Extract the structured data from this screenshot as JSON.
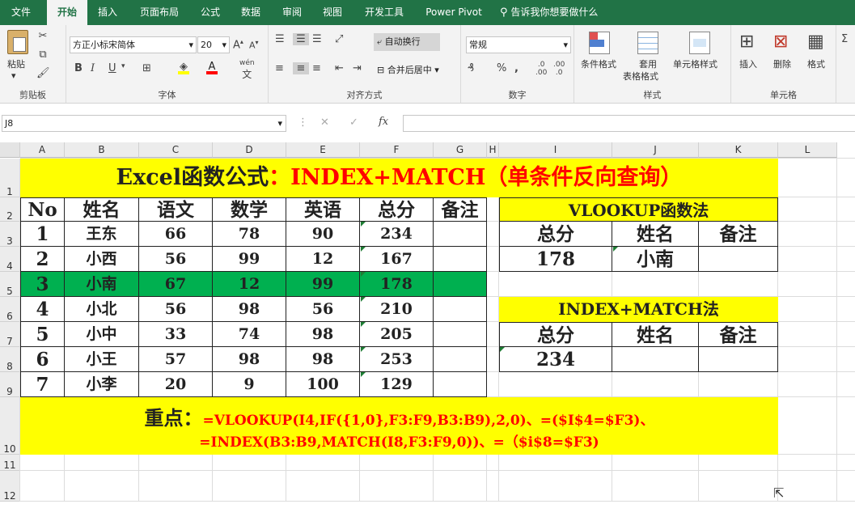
{
  "tabs": [
    "文件",
    "开始",
    "插入",
    "页面布局",
    "公式",
    "数据",
    "审阅",
    "视图",
    "开发工具",
    "Power Pivot"
  ],
  "tell_me": "告诉我你想要做什么",
  "ribbon": {
    "clipboard": {
      "paste": "粘贴",
      "label": "剪贴板"
    },
    "font": {
      "name": "方正小标宋简体",
      "size": "20",
      "label": "字体",
      "wen": "wén"
    },
    "align": {
      "wrap": "自动换行",
      "merge": "合并后居中",
      "label": "对齐方式"
    },
    "number": {
      "format": "常规",
      "label": "数字"
    },
    "styles": {
      "cond": "条件格式",
      "table1": "套用",
      "table2": "表格格式",
      "cell": "单元格样式",
      "label": "样式"
    },
    "cells": {
      "insert": "插入",
      "delete": "删除",
      "format": "格式",
      "label": "单元格"
    }
  },
  "formula_bar": {
    "name_box": "J8",
    "fx": "fx"
  },
  "columns": [
    "A",
    "B",
    "C",
    "D",
    "E",
    "F",
    "G",
    "H",
    "I",
    "J",
    "K",
    "L"
  ],
  "rows": [
    "1",
    "2",
    "3",
    "4",
    "5",
    "6",
    "7",
    "8",
    "9",
    "10",
    "11",
    "12"
  ],
  "sheet": {
    "title_black": "Excel函数公式",
    "title_red": "：INDEX+MATCH（单条件反向查询）",
    "headers": [
      "No",
      "姓名",
      "语文",
      "数学",
      "英语",
      "总分",
      "备注"
    ],
    "data": [
      [
        "1",
        "王东",
        "66",
        "78",
        "90",
        "234",
        ""
      ],
      [
        "2",
        "小西",
        "56",
        "99",
        "12",
        "167",
        ""
      ],
      [
        "3",
        "小南",
        "67",
        "12",
        "99",
        "178",
        ""
      ],
      [
        "4",
        "小北",
        "56",
        "98",
        "56",
        "210",
        ""
      ],
      [
        "5",
        "小中",
        "33",
        "74",
        "98",
        "205",
        ""
      ],
      [
        "6",
        "小王",
        "57",
        "98",
        "98",
        "253",
        ""
      ],
      [
        "7",
        "小李",
        "20",
        "9",
        "100",
        "129",
        ""
      ]
    ],
    "vlookup_title": "VLOOKUP函数法",
    "vlookup_headers": [
      "总分",
      "姓名",
      "备注"
    ],
    "vlookup_values": [
      "178",
      "小南",
      ""
    ],
    "index_title": "INDEX+MATCH法",
    "index_headers": [
      "总分",
      "姓名",
      "备注"
    ],
    "index_values": [
      "234",
      "",
      ""
    ],
    "key_label": "重点：",
    "key_line1": "=VLOOKUP(I4,IF({1,0},F3:F9,B3:B9),2,0)、=($I$4=$F3)、",
    "key_line2": "=INDEX(B3:B9,MATCH(I8,F3:F9,0))、=（$i$8=$F3)"
  },
  "colors": {
    "excel_green": "#217346",
    "highlight_yellow": "#ffff00",
    "row_green": "#00b050",
    "title_red": "#ff0000"
  }
}
